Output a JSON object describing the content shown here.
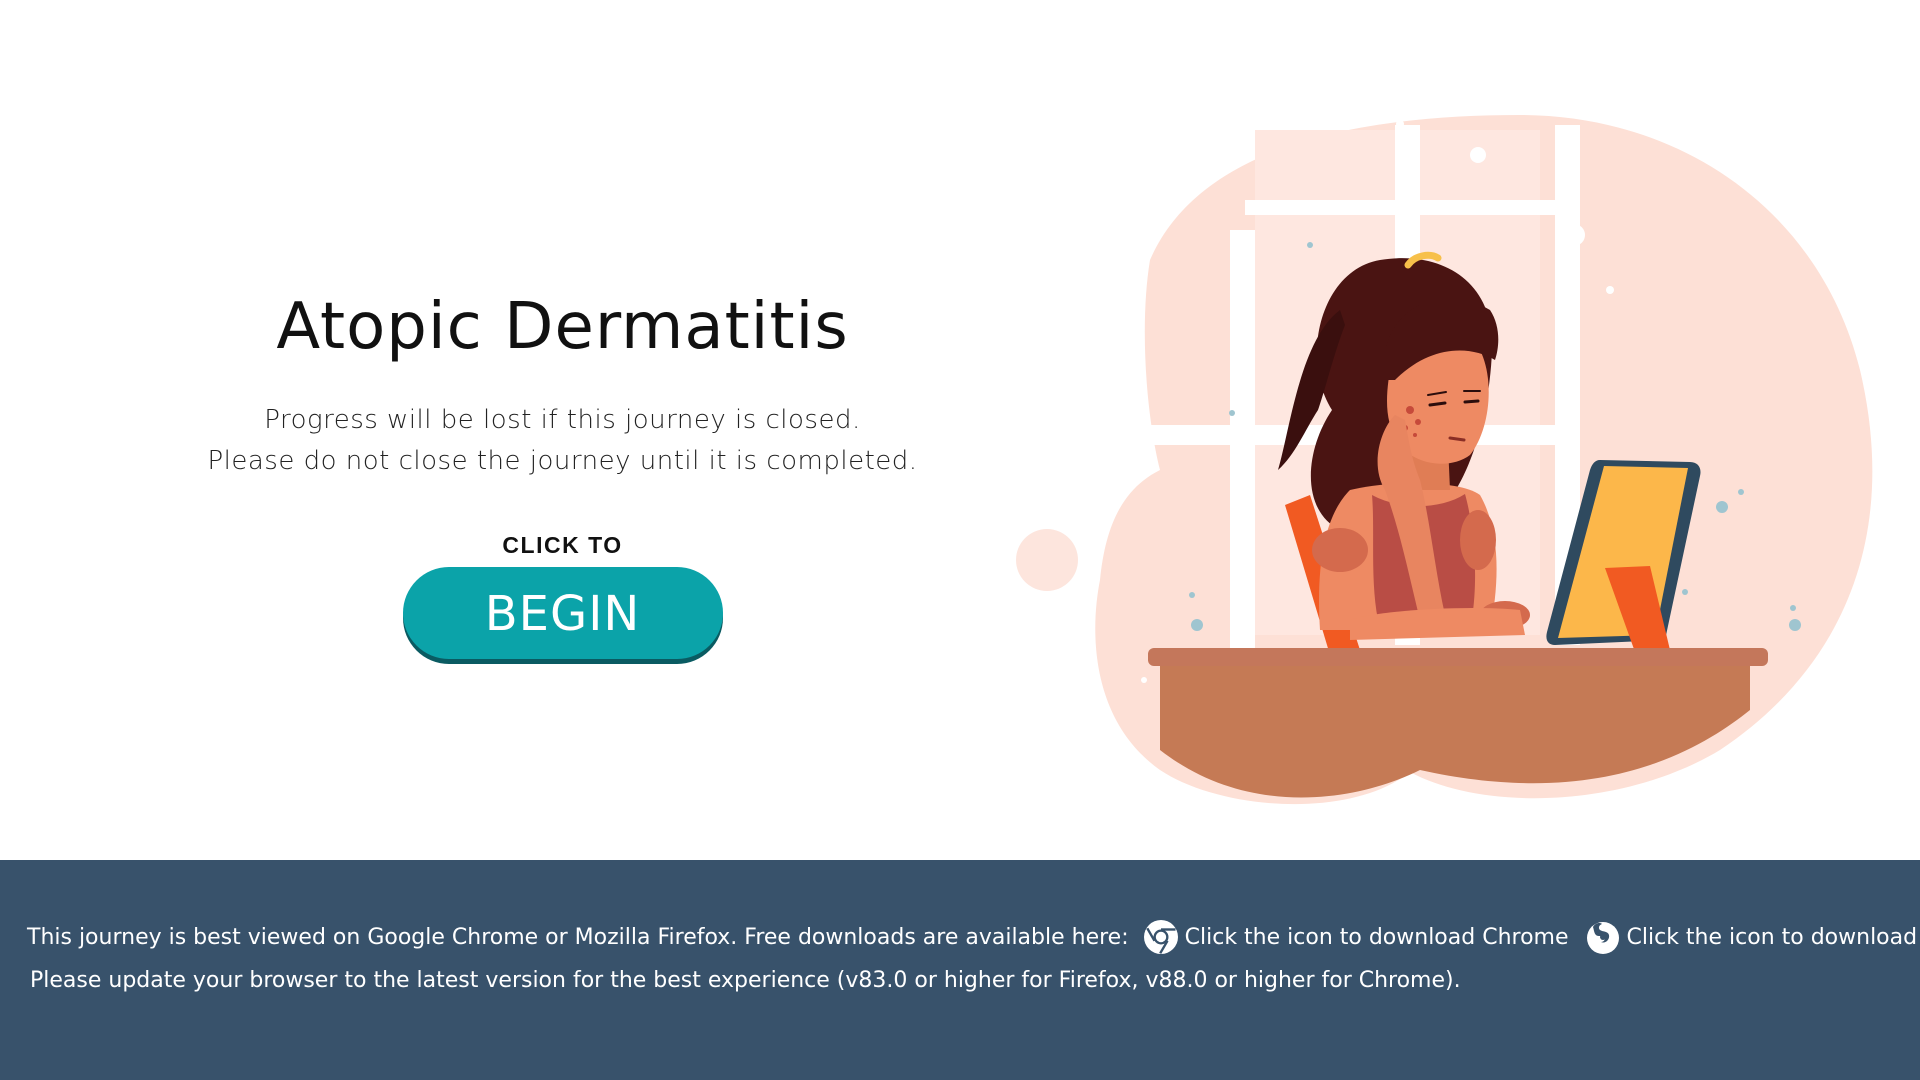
{
  "page": {
    "title": "Atopic Dermatitis",
    "warning_line1": "Progress will be lost if this journey is closed.",
    "warning_line2": "Please do not close the journey until it is completed.",
    "click_to_label": "CLICK TO",
    "begin_label": "BEGIN"
  },
  "footer": {
    "browser_note": "This journey is best viewed on Google Chrome or Mozilla Firefox. Free downloads are available here:",
    "chrome_label": "Click the icon to download Chrome",
    "firefox_label": "Click the icon to download Firefox",
    "update_note": "Please update your browser to the latest version for the best experience (v83.0 or higher for Firefox, v88.0 or higher for Chrome)."
  },
  "icons": {
    "chrome": "chrome-icon",
    "firefox": "firefox-icon"
  },
  "colors": {
    "accent": "#0ba3a9",
    "footer_bg": "#38526b",
    "blob": "#fde0d6"
  }
}
